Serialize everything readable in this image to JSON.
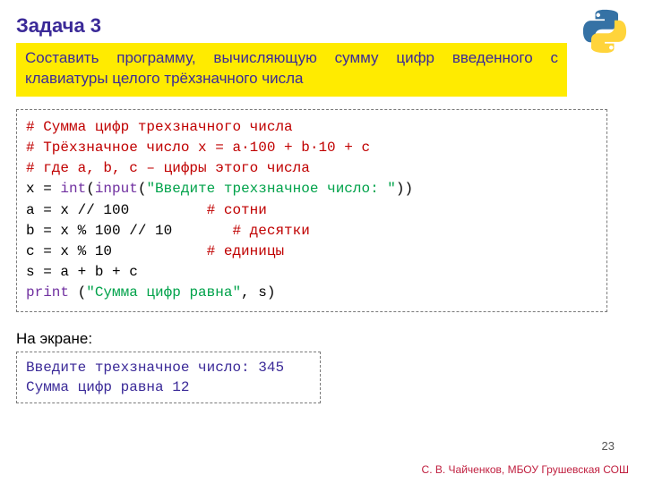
{
  "title": "Задача 3",
  "task_text": "Составить программу, вычисляющую сумму цифр введенного с клавиатуры целого трёхзначного числа",
  "code": {
    "c1": "# Сумма цифр трехзначного числа",
    "c2": "# Трёхзначное число x = a∙100 + b∙10 + c",
    "c3": "# где a, b, c – цифры этого числа",
    "l4a": "x = ",
    "l4_fn1": "int",
    "l4b": "(",
    "l4_fn2": "input",
    "l4c": "(",
    "l4_str": "\"Введите трехзначное число: \"",
    "l4d": "))",
    "l5a": "a = x // 100         ",
    "l5c": "# сотни",
    "l6a": "b = x % 100 // 10       ",
    "l6c": "# десятки",
    "l7a": "c = x % 10           ",
    "l7c": "# единицы",
    "l8": "s = a + b + c",
    "l9_fn": "print",
    "l9a": " (",
    "l9_str": "\"Сумма цифр равна\"",
    "l9b": ", s)"
  },
  "screen_label": "На экране:",
  "output": "Введите трехзначное число: 345\nСумма цифр равна 12",
  "page_number": "23",
  "footer": "С. В. Чайченков, МБОУ Грушевская СОШ"
}
